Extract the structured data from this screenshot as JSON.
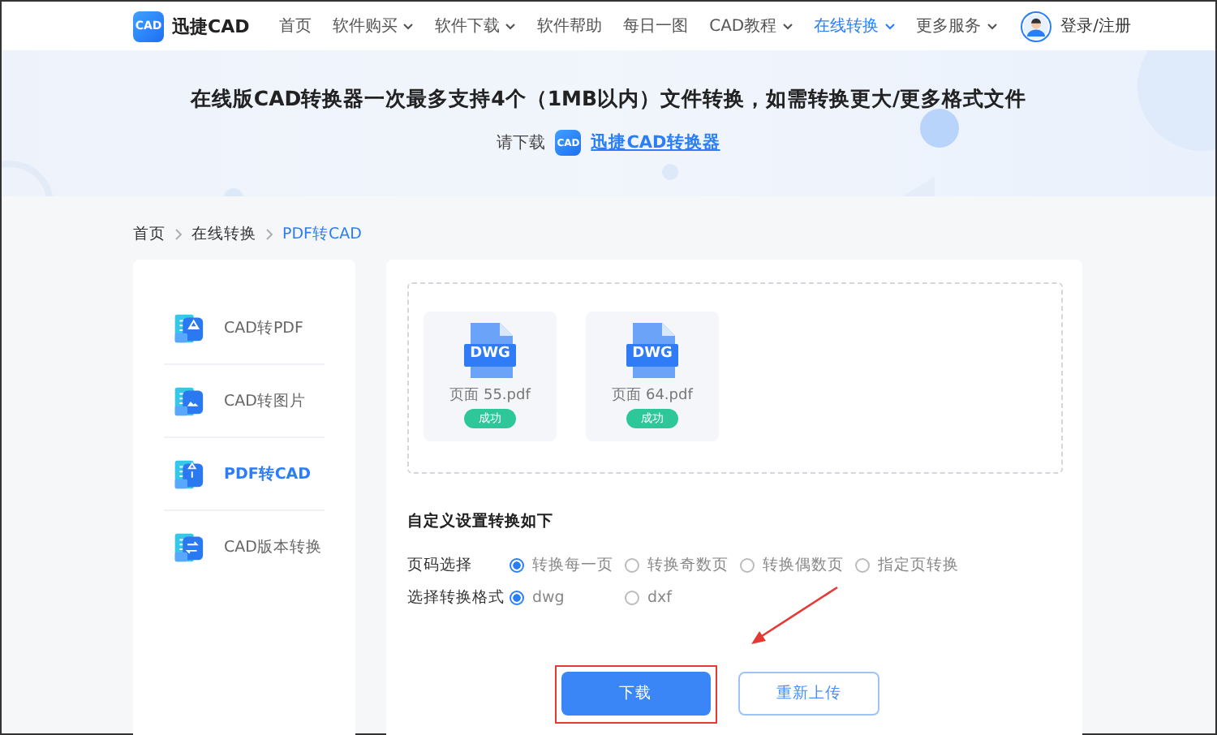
{
  "header": {
    "logo_text": "CAD",
    "brand": "迅捷CAD",
    "nav": [
      {
        "label": "首页",
        "selected": false,
        "dropdown": false
      },
      {
        "label": "软件购买",
        "selected": false,
        "dropdown": true
      },
      {
        "label": "软件下载",
        "selected": false,
        "dropdown": true
      },
      {
        "label": "软件帮助",
        "selected": false,
        "dropdown": false
      },
      {
        "label": "每日一图",
        "selected": false,
        "dropdown": false
      },
      {
        "label": "CAD教程",
        "selected": false,
        "dropdown": true
      },
      {
        "label": "在线转换",
        "selected": true,
        "dropdown": true
      },
      {
        "label": "更多服务",
        "selected": false,
        "dropdown": true
      }
    ],
    "login": "登录/注册"
  },
  "banner": {
    "title": "在线版CAD转换器一次最多支持4个（1MB以内）文件转换，如需转换更大/更多格式文件",
    "prompt": "请下载",
    "app_icon_text": "CAD",
    "link": "迅捷CAD转换器"
  },
  "breadcrumb": [
    {
      "label": "首页",
      "selected": false
    },
    {
      "label": "在线转换",
      "selected": false
    },
    {
      "label": "PDF转CAD",
      "selected": true
    }
  ],
  "sidebar": {
    "items": [
      {
        "label": "CAD转PDF",
        "selected": false,
        "kind": "pdf"
      },
      {
        "label": "CAD转图片",
        "selected": false,
        "kind": "image"
      },
      {
        "label": "PDF转CAD",
        "selected": true,
        "kind": "cad"
      },
      {
        "label": "CAD版本转换",
        "selected": false,
        "kind": "version"
      }
    ]
  },
  "files": [
    {
      "type_label": "DWG",
      "name": "页面 55.pdf",
      "status": "成功"
    },
    {
      "type_label": "DWG",
      "name": "页面 64.pdf",
      "status": "成功"
    }
  ],
  "settings": {
    "title": "自定义设置转换如下",
    "rows": [
      {
        "label": "页码选择",
        "options": [
          {
            "label": "转换每一页",
            "selected": true
          },
          {
            "label": "转换奇数页",
            "selected": false
          },
          {
            "label": "转换偶数页",
            "selected": false
          },
          {
            "label": "指定页转换",
            "selected": false
          }
        ]
      },
      {
        "label": "选择转换格式",
        "options": [
          {
            "label": "dwg",
            "selected": true
          },
          {
            "label": "dxf",
            "selected": false
          }
        ]
      }
    ]
  },
  "buttons": [
    {
      "label": "下载",
      "kind": "primary",
      "highlighted": true
    },
    {
      "label": "重新上传",
      "kind": "outline",
      "highlighted": false
    }
  ]
}
